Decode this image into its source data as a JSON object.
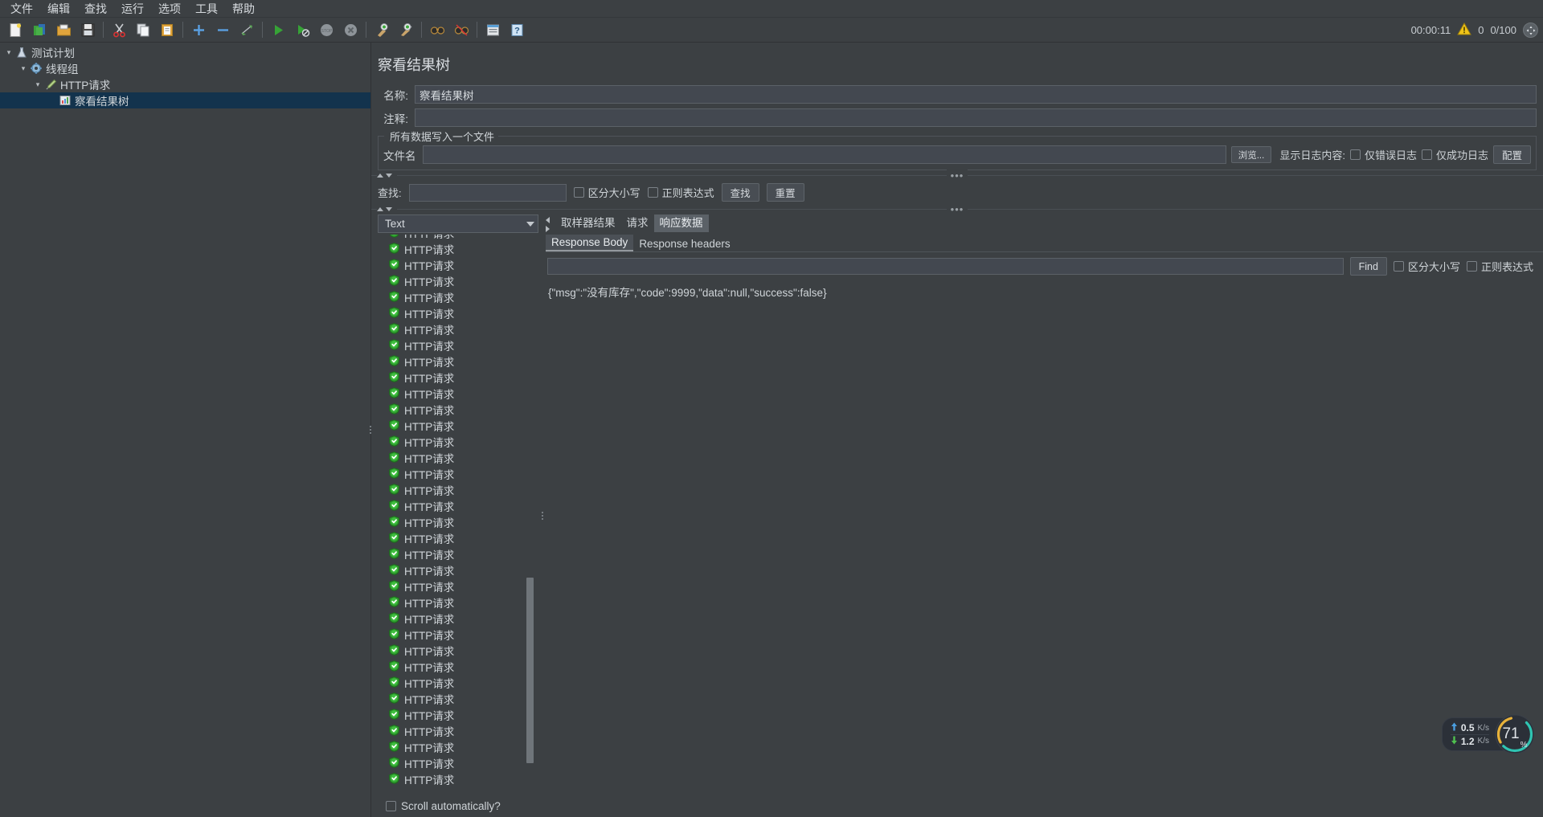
{
  "menubar": {
    "items": [
      {
        "label": "文件"
      },
      {
        "label": "编辑"
      },
      {
        "label": "查找"
      },
      {
        "label": "运行"
      },
      {
        "label": "选项"
      },
      {
        "label": "工具"
      },
      {
        "label": "帮助"
      }
    ]
  },
  "toolbar": {
    "buttons": [
      {
        "name": "new-icon",
        "title": "新建"
      },
      {
        "name": "templates-icon",
        "title": "模板"
      },
      {
        "name": "open-icon",
        "title": "打开"
      },
      {
        "name": "save-icon",
        "title": "保存"
      },
      {
        "name": "cut-icon",
        "title": "剪切"
      },
      {
        "name": "copy-icon",
        "title": "复制"
      },
      {
        "name": "paste-icon",
        "title": "粘贴"
      },
      {
        "name": "expand-all-icon",
        "title": "展开全部"
      },
      {
        "name": "collapse-all-icon",
        "title": "折叠全部"
      },
      {
        "name": "toggle-icon",
        "title": "切换"
      },
      {
        "name": "start-icon",
        "title": "启动"
      },
      {
        "name": "start-no-pause-icon",
        "title": "无间隔启动"
      },
      {
        "name": "stop-icon",
        "title": "停止"
      },
      {
        "name": "shutdown-icon",
        "title": "关闭"
      },
      {
        "name": "clear-icon",
        "title": "清除"
      },
      {
        "name": "clear-all-icon",
        "title": "清除全部"
      },
      {
        "name": "search-icon",
        "title": "搜索"
      },
      {
        "name": "reset-search-icon",
        "title": "重置搜索"
      },
      {
        "name": "function-helper-icon",
        "title": "函数助手"
      },
      {
        "name": "help-icon",
        "title": "帮助"
      }
    ],
    "status": {
      "elapsed": "00:00:11",
      "warning_icon": "warning-icon",
      "warning_count": "0",
      "threads": "0/100",
      "expand_icon": "expand-icon"
    }
  },
  "tree": {
    "nodes": [
      {
        "label": "测试计划",
        "icon": "test-plan-icon",
        "depth": 0,
        "twisty": "open",
        "selected": false
      },
      {
        "label": "线程组",
        "icon": "thread-group-icon",
        "depth": 1,
        "twisty": "open",
        "selected": false
      },
      {
        "label": "HTTP请求",
        "icon": "http-request-icon",
        "depth": 2,
        "twisty": "open",
        "selected": false
      },
      {
        "label": "察看结果树",
        "icon": "view-results-tree-icon",
        "depth": 3,
        "twisty": "none",
        "selected": true
      }
    ]
  },
  "panel": {
    "title": "察看结果树",
    "name_label": "名称:",
    "name_value": "察看结果树",
    "comment_label": "注释:",
    "comment_value": "",
    "group_legend": "所有数据写入一个文件",
    "filename_label": "文件名",
    "filename_value": "",
    "browse_label": "浏览...",
    "log_display_label": "显示日志内容:",
    "errors_only_label": "仅错误日志",
    "errors_only_checked": false,
    "successes_only_label": "仅成功日志",
    "successes_only_checked": false,
    "configure_label": "配置"
  },
  "search": {
    "label": "查找:",
    "value": "",
    "case_sensitive_label": "区分大小写",
    "case_sensitive_checked": false,
    "regex_label": "正则表达式",
    "regex_checked": false,
    "find_label": "查找",
    "reset_label": "重置"
  },
  "results": {
    "renderer_selected": "Text",
    "item_label": "HTTP请求",
    "item_icon": "success-shield-icon",
    "item_count": 35,
    "auto_scroll_label": "Scroll automatically?",
    "auto_scroll_checked": false
  },
  "detail": {
    "tabs": [
      {
        "label": "取样器结果",
        "active": false
      },
      {
        "label": "请求",
        "active": false
      },
      {
        "label": "响应数据",
        "active": true
      }
    ],
    "subtabs": [
      {
        "label": "Response Body",
        "active": true
      },
      {
        "label": "Response headers",
        "active": false
      }
    ],
    "find_value": "",
    "find_label": "Find",
    "case_sensitive_label": "区分大小写",
    "case_sensitive_checked": false,
    "regex_label": "正则表达式",
    "regex_checked": false,
    "response_body": "{\"msg\":\"没有库存\",\"code\":9999,\"data\":null,\"success\":false}"
  },
  "net_widget": {
    "upload_value": "0.5",
    "upload_unit": "K/s",
    "download_value": "1.2",
    "download_unit": "K/s",
    "percent": "71",
    "percent_symbol": "%",
    "ring_colors": {
      "teal": "#2fc4b2",
      "yellow": "#e8b23a",
      "track": "#2b3038"
    }
  },
  "colors": {
    "background": "#3c4043",
    "selection": "#13334d",
    "field": "#434850",
    "border": "#5b6167",
    "text": "#cfd4d8",
    "accent_green": "#3aa33a"
  }
}
